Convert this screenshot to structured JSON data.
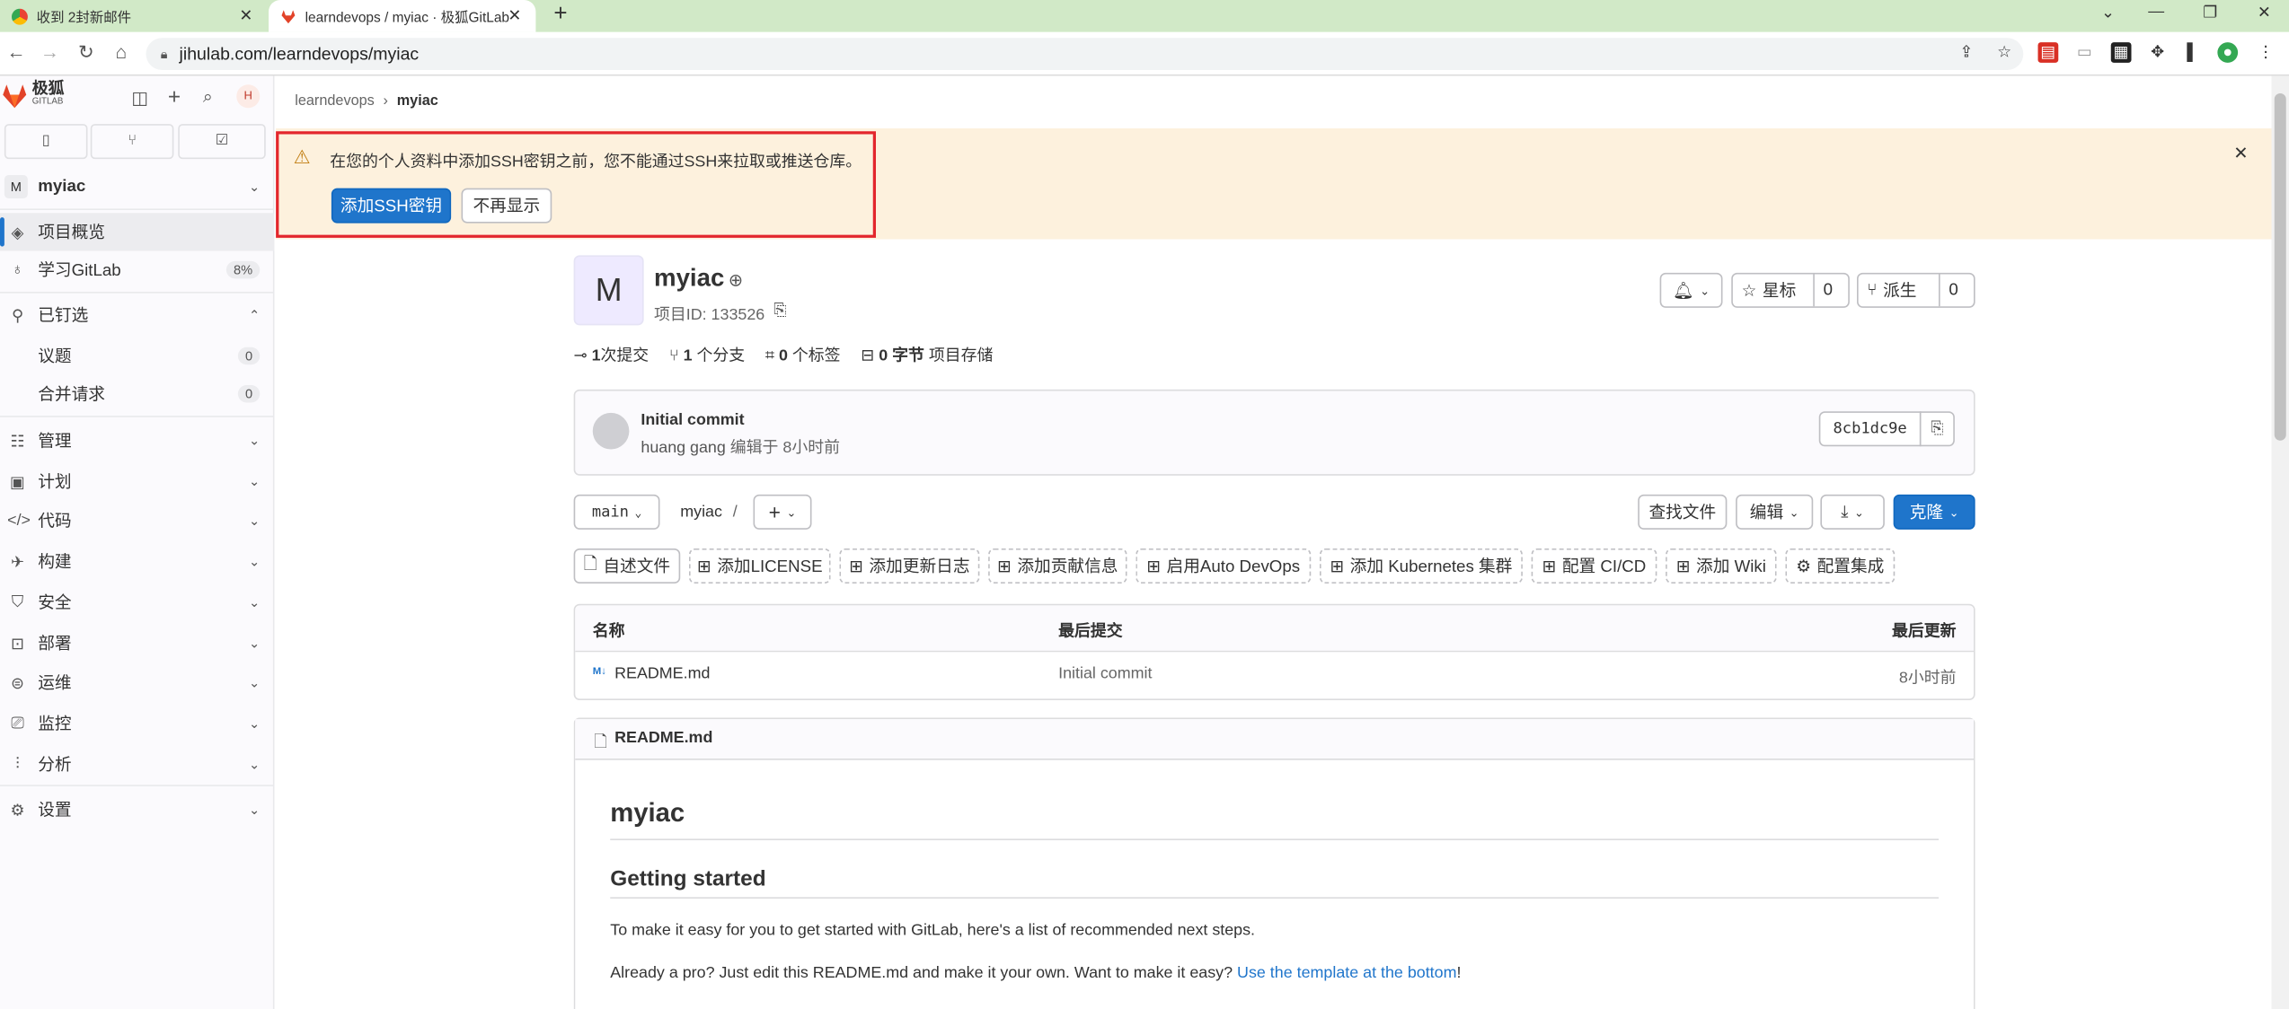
{
  "browser": {
    "tabs": [
      {
        "title": "收到 2封新邮件",
        "icon": "mail-favicon"
      },
      {
        "title": "learndevops / myiac · 极狐GitLab",
        "icon": "gitlab-favicon",
        "active": true
      }
    ],
    "url": "jihulab.com/learndevops/myiac"
  },
  "sidebar": {
    "brand": "极狐",
    "brand_sub": "GITLAB",
    "avatar_letter": "H",
    "project_letter": "M",
    "project_name": "myiac",
    "items": [
      {
        "label": "项目概览",
        "icon": "overview-icon",
        "active": true
      },
      {
        "label": "学习GitLab",
        "icon": "learn-icon",
        "count": "8%"
      },
      {
        "label": "已钉选",
        "icon": "pin-icon",
        "expanded": true
      },
      {
        "label": "议题",
        "count": "0"
      },
      {
        "label": "合并请求",
        "count": "0"
      },
      {
        "label": "管理",
        "icon": "manage-icon"
      },
      {
        "label": "计划",
        "icon": "plan-icon"
      },
      {
        "label": "代码",
        "icon": "code-icon"
      },
      {
        "label": "构建",
        "icon": "build-icon"
      },
      {
        "label": "安全",
        "icon": "security-icon"
      },
      {
        "label": "部署",
        "icon": "deploy-icon"
      },
      {
        "label": "运维",
        "icon": "operate-icon"
      },
      {
        "label": "监控",
        "icon": "monitor-icon"
      },
      {
        "label": "分析",
        "icon": "analytics-icon"
      },
      {
        "label": "设置",
        "icon": "settings-icon"
      }
    ]
  },
  "breadcrumb": {
    "group": "learndevops",
    "project": "myiac"
  },
  "alert": {
    "message": "在您的个人资料中添加SSH密钥之前，您不能通过SSH来拉取或推送仓库。",
    "add_key": "添加SSH密钥",
    "dismiss": "不再显示"
  },
  "project": {
    "avatar_letter": "M",
    "name": "myiac",
    "id_label": "项目ID: 133526",
    "star_label": "星标",
    "star_count": "0",
    "fork_label": "派生",
    "fork_count": "0",
    "stats": [
      {
        "num": "1",
        "label": "次提交"
      },
      {
        "num": "1",
        "label": "个分支"
      },
      {
        "num": "0",
        "label": "个标签"
      },
      {
        "num": "0 字节",
        "label": "项目存储"
      }
    ]
  },
  "commit": {
    "title": "Initial commit",
    "author": "huang gang",
    "meta": "编辑于 8小时前",
    "sha": "8cb1dc9e"
  },
  "repo": {
    "branch": "main",
    "path": "myiac",
    "path_sep": "/",
    "find_file": "查找文件",
    "edit": "编辑",
    "clone": "克隆",
    "quick_actions": [
      "自述文件",
      "添加LICENSE",
      "添加更新日志",
      "添加贡献信息",
      "启用Auto DevOps",
      "添加 Kubernetes 集群",
      "配置 CI/CD",
      "添加 Wiki",
      "配置集成"
    ]
  },
  "file_table": {
    "headers": [
      "名称",
      "最后提交",
      "最后更新"
    ],
    "rows": [
      {
        "name": "README.md",
        "commit": "Initial commit",
        "updated": "8小时前"
      }
    ]
  },
  "readme": {
    "filename": "README.md",
    "h1": "myiac",
    "h2": "Getting started",
    "p1": "To make it easy for you to get started with GitLab, here's a list of recommended next steps.",
    "p2": "Already a pro? Just edit this README.md and make it your own. Want to make it easy?",
    "p2_link": "Use the template at the bottom",
    "p2_end": "!"
  }
}
